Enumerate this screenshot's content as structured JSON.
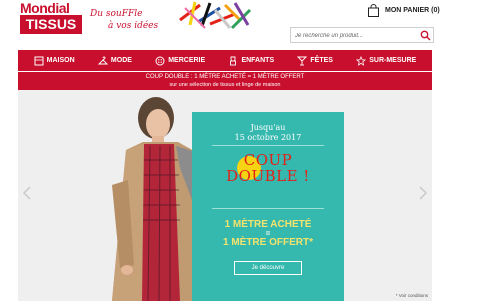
{
  "brand": {
    "line1": "Mondial",
    "line2": "TISSUS",
    "slogan_line1": "Du souFFle",
    "slogan_line2": "à vos idées"
  },
  "cart": {
    "label": "MON PANIER (0)"
  },
  "search": {
    "placeholder": "Je recherche un produit..."
  },
  "nav": {
    "items": [
      {
        "label": "MAISON",
        "icon": "house-icon"
      },
      {
        "label": "MODE",
        "icon": "hanger-icon"
      },
      {
        "label": "MERCERIE",
        "icon": "button-icon"
      },
      {
        "label": "ENFANTS",
        "icon": "bib-icon"
      },
      {
        "label": "FÊTES",
        "icon": "party-icon"
      },
      {
        "label": "SUR-MESURE",
        "icon": "ruler-icon"
      }
    ]
  },
  "promo": {
    "line1": "COUP DOUBLE : 1 MÈTRE ACHETÉ = 1 MÈTRE OFFERT",
    "line2": "sur une sélection de tissus et linge de maison"
  },
  "hero": {
    "date_line1": "Jusqu'au",
    "date_line2": "15 octobre 2017",
    "coup": "COUP",
    "double": "DOUBLE !",
    "offer_line1": "1 MÈTRE ACHETÉ",
    "equals": "=",
    "offer_line2": "1 MÈTRE OFFERT*",
    "cta": "Je découvre",
    "conditions": "* Voir conditions"
  },
  "colors": {
    "brand_red": "#c8102e",
    "panel_teal": "#35b8ae",
    "offer_yellow": "#f4e36c",
    "coup_red": "#e32119"
  }
}
